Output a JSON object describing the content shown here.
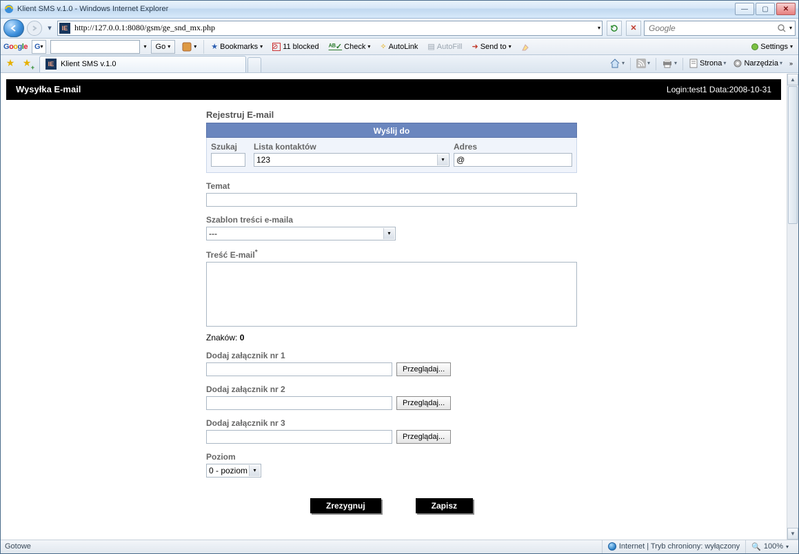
{
  "window": {
    "title": "Klient SMS v.1.0 - Windows Internet Explorer"
  },
  "nav": {
    "url": "http://127.0.0.1:8080/gsm/ge_snd_mx.php",
    "search_placeholder": "Google"
  },
  "googlebar": {
    "go": "Go",
    "bookmarks": "Bookmarks",
    "blocked": "11 blocked",
    "check": "Check",
    "autolink": "AutoLink",
    "autofill": "AutoFill",
    "sendto": "Send to",
    "settings": "Settings"
  },
  "tab": {
    "title": "Klient SMS v.1.0"
  },
  "cmdbar": {
    "page": "Strona",
    "tools": "Narzędzia"
  },
  "header": {
    "title": "Wysyłka E-mail",
    "login": "Login:test1 Data:2008-10-31"
  },
  "form": {
    "register": "Rejestruj E-mail",
    "sendto_header": "Wyślij do",
    "search_label": "Szukaj",
    "contacts_label": "Lista kontaktów",
    "contacts_value": "123",
    "address_label": "Adres",
    "address_value": "@",
    "subject_label": "Temat",
    "subject_value": "",
    "template_label": "Szablon treści e-maila",
    "template_value": "---",
    "body_label": "Treść E-mail",
    "charcount_label": "Znaków: ",
    "charcount_value": "0",
    "att1_label": "Dodaj załącznik nr 1",
    "att2_label": "Dodaj załącznik nr 2",
    "att3_label": "Dodaj załącznik nr 3",
    "browse": "Przeglądaj...",
    "level_label": "Poziom",
    "level_value": "0 - poziom",
    "cancel": "Zrezygnuj",
    "save": "Zapisz"
  },
  "status": {
    "ready": "Gotowe",
    "zone": "Internet | Tryb chroniony: wyłączony",
    "zoom": "100%"
  }
}
